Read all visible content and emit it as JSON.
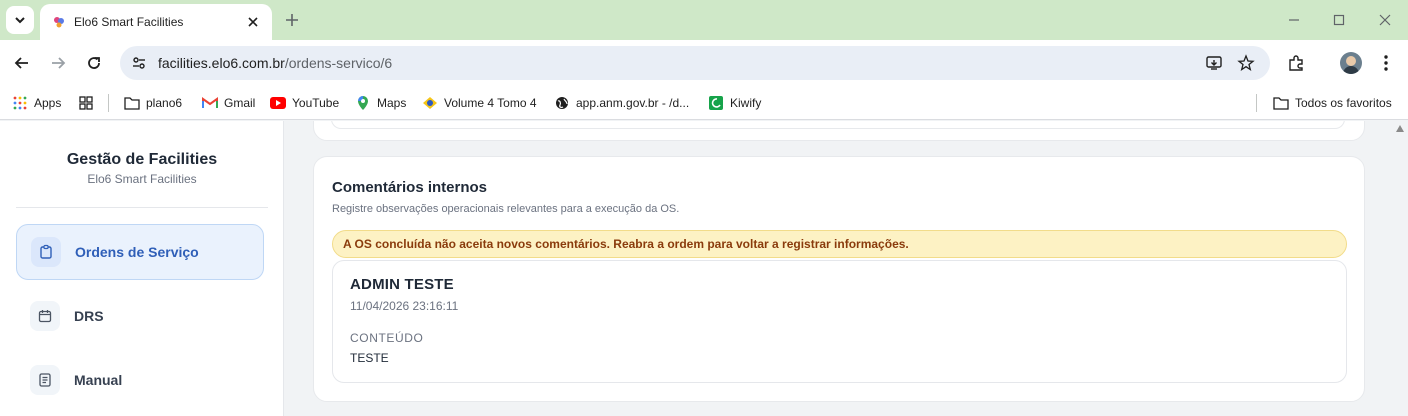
{
  "browser": {
    "tab_title": "Elo6 Smart Facilities",
    "url_host": "facilities.elo6.com.br",
    "url_path": "/ordens-servico/6",
    "bookmarks": {
      "apps": "Apps",
      "plano6": "plano6",
      "gmail": "Gmail",
      "youtube": "YouTube",
      "maps": "Maps",
      "volume": "Volume 4 Tomo 4",
      "anm": "app.anm.gov.br - /d...",
      "kiwify": "Kiwify",
      "all": "Todos os favoritos"
    },
    "colors": {
      "tabstrip": "#cfe8c8",
      "omnibox": "#e9eef6"
    }
  },
  "sidebar": {
    "title": "Gestão de Facilities",
    "subtitle": "Elo6 Smart Facilities",
    "items": [
      {
        "label": "Ordens de Serviço",
        "icon": "clipboard-icon",
        "active": true
      },
      {
        "label": "DRS",
        "icon": "calendar-icon",
        "active": false
      },
      {
        "label": "Manual",
        "icon": "document-icon",
        "active": false
      }
    ]
  },
  "comments": {
    "title": "Comentários internos",
    "subtitle": "Registre observações operacionais relevantes para a execução da OS.",
    "alert": "A OS concluída não aceita novos comentários. Reabra a ordem para voltar a registrar informações.",
    "entries": [
      {
        "author": "ADMIN TESTE",
        "date": "11/04/2026 23:16:11",
        "content_label": "CONTEÚDO",
        "content": "TESTE"
      }
    ]
  },
  "theme": {
    "accent": "#2f5fb8",
    "alert_bg": "#fdf2c4",
    "alert_text": "#8a3b0c"
  }
}
